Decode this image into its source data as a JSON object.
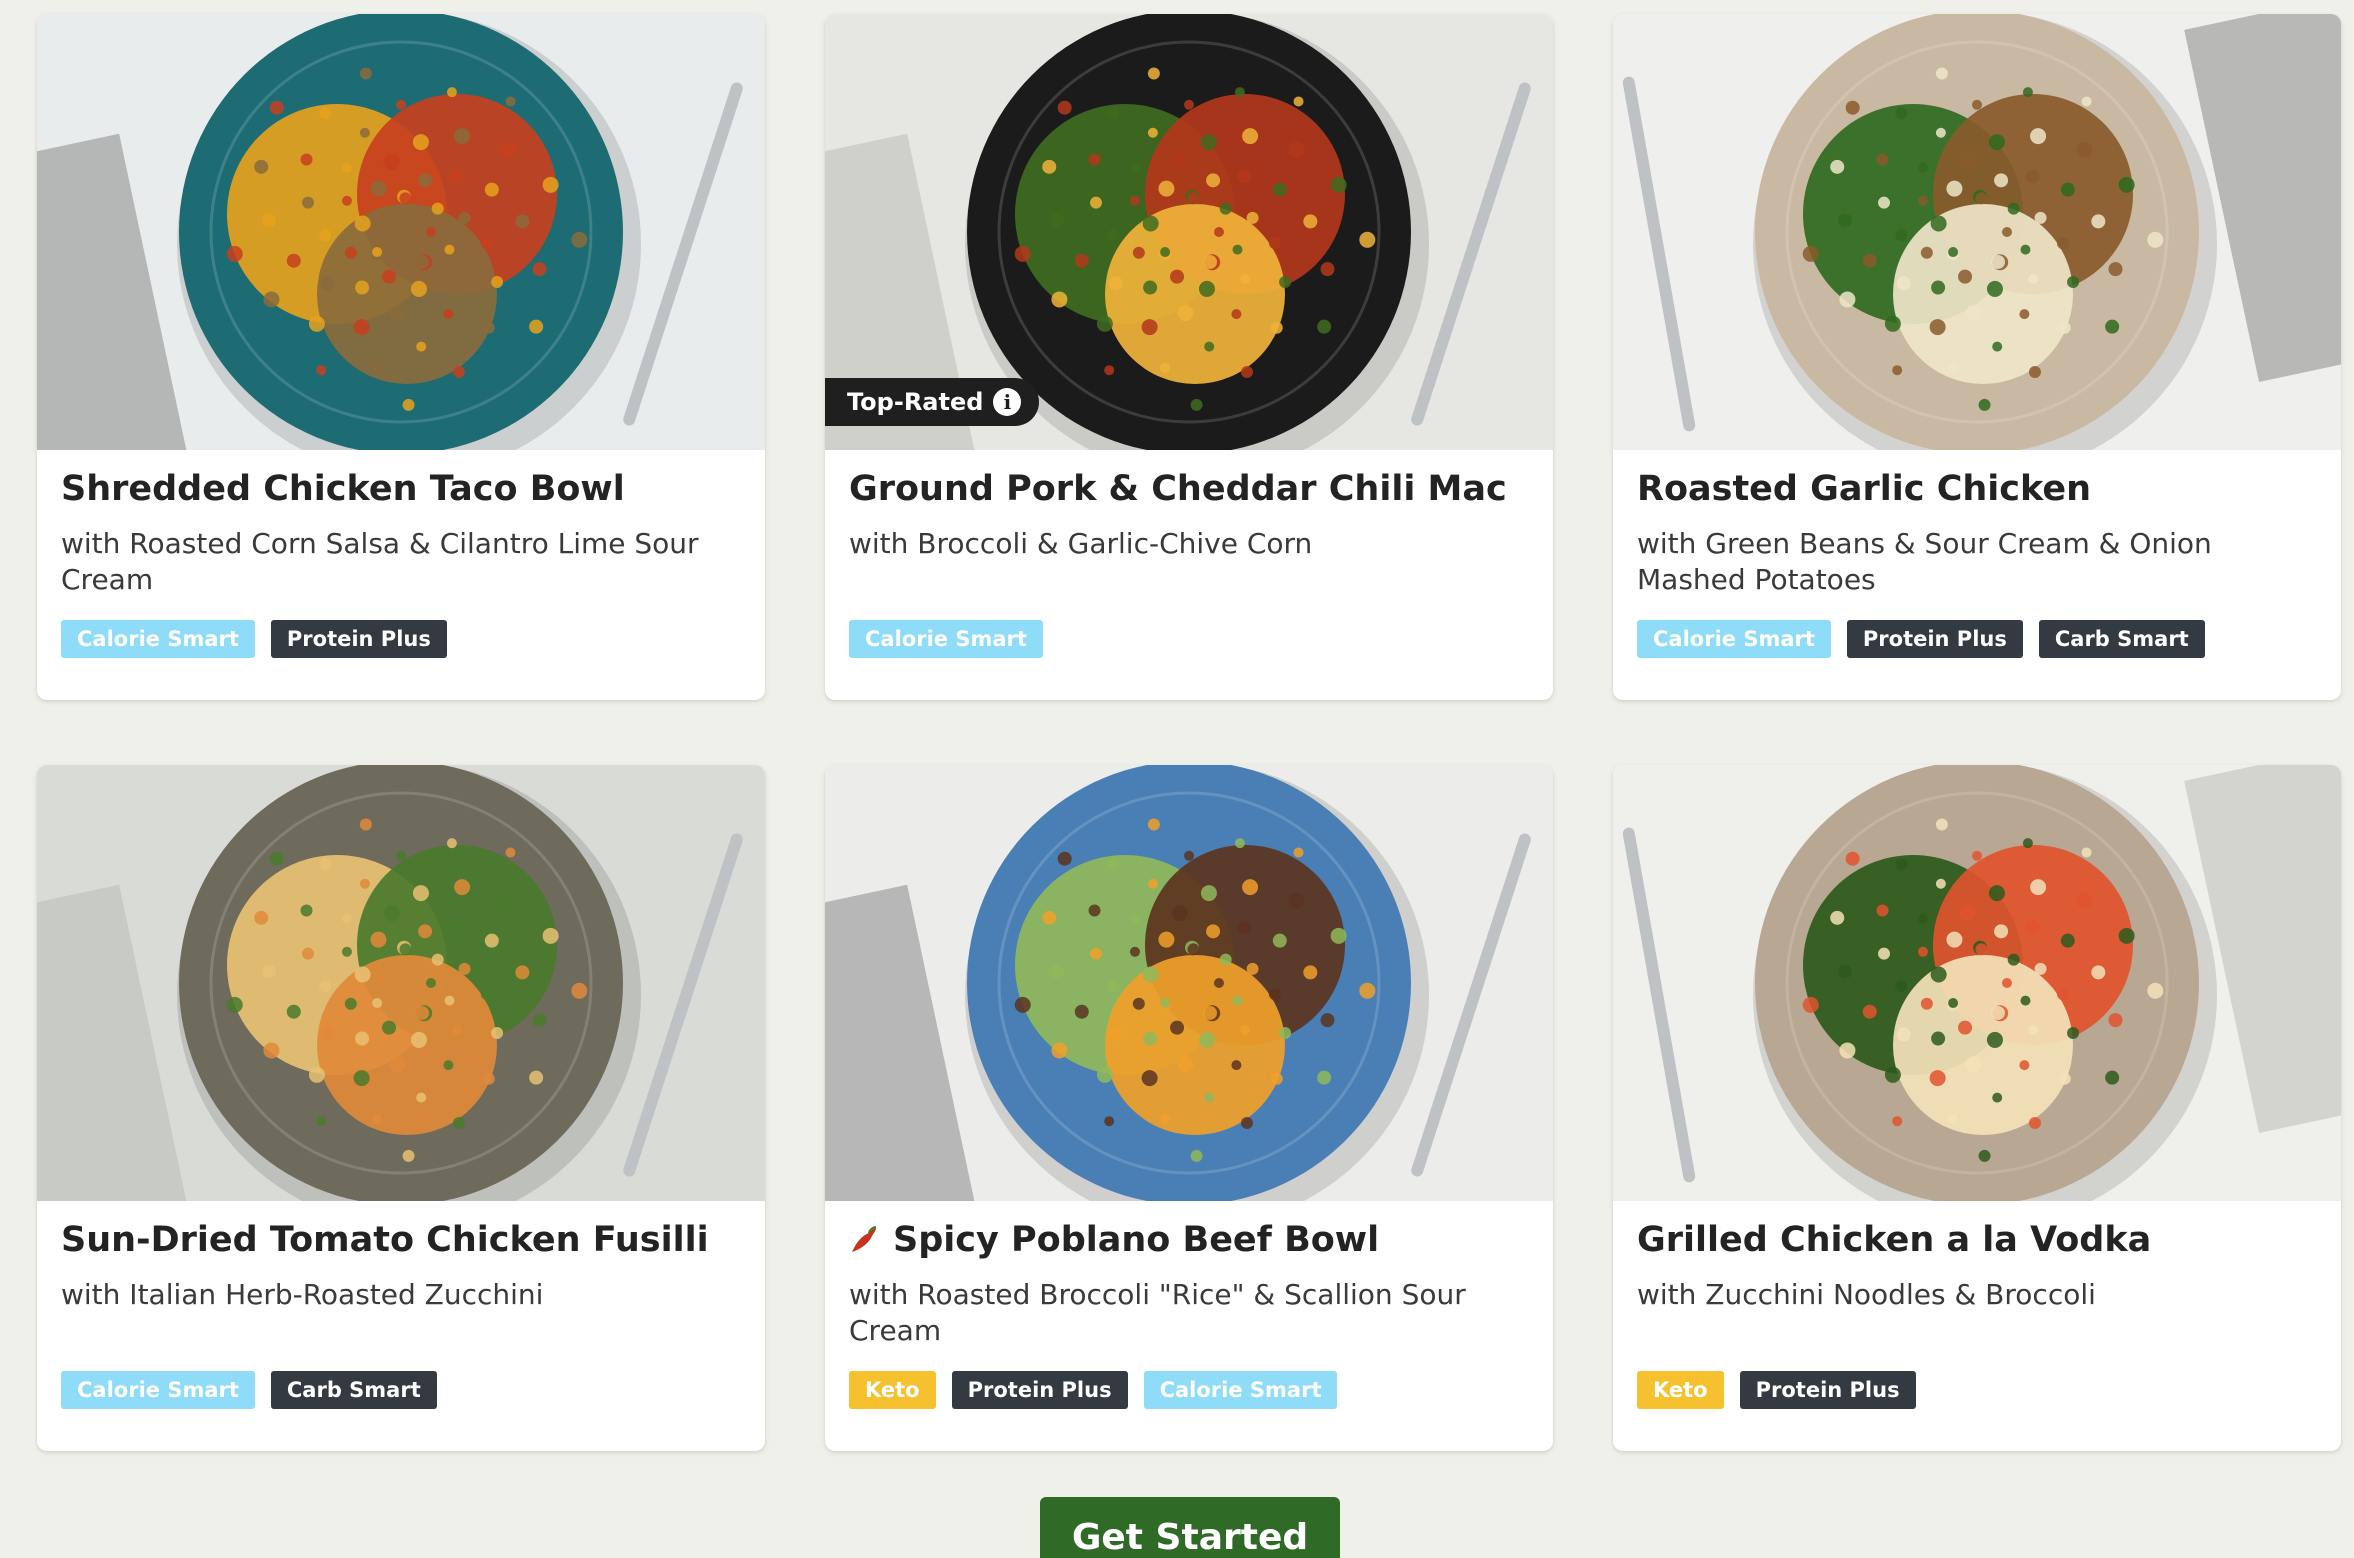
{
  "meals": [
    {
      "title": "Shredded Chicken Taco Bowl",
      "subtitle": "with Roasted Corn Salsa & Cilantro Lime Sour Cream",
      "tags": [
        {
          "label": "Calorie Smart",
          "kind": "calorie"
        },
        {
          "label": "Protein Plus",
          "kind": "protein"
        }
      ],
      "image": {
        "bg": "#e9ecec",
        "plate": "#1d6b73",
        "food": [
          "#e6a21d",
          "#c7401e",
          "#8a6b3c"
        ]
      }
    },
    {
      "title": "Ground Pork & Cheddar Chili Mac",
      "subtitle": "with Broccoli & Garlic-Chive Corn",
      "badge": "Top-Rated",
      "tags": [
        {
          "label": "Calorie Smart",
          "kind": "calorie"
        }
      ],
      "image": {
        "bg": "#e6e6e3",
        "plate": "#1b1b1b",
        "food": [
          "#3f6b1f",
          "#b3371b",
          "#f0b33a"
        ]
      }
    },
    {
      "title": "Roasted Garlic Chicken",
      "subtitle": "with Green Beans & Sour Cream & Onion Mashed Potatoes",
      "tags": [
        {
          "label": "Calorie Smart",
          "kind": "calorie"
        },
        {
          "label": "Protein Plus",
          "kind": "protein"
        },
        {
          "label": "Carb Smart",
          "kind": "carb"
        }
      ],
      "image": {
        "bg": "#efefed",
        "plate": "#c9b9a2",
        "food": [
          "#2f6a1f",
          "#8a5a2c",
          "#efe5c8"
        ]
      }
    },
    {
      "title": "Sun-Dried Tomato Chicken Fusilli",
      "subtitle": "with Italian Herb-Roasted Zucchini",
      "tags": [
        {
          "label": "Calorie Smart",
          "kind": "calorie"
        },
        {
          "label": "Carb Smart",
          "kind": "carb"
        }
      ],
      "image": {
        "bg": "#d9dbd6",
        "plate": "#6e6a5c",
        "food": [
          "#e8c173",
          "#4a7a2c",
          "#e08a3a"
        ]
      }
    },
    {
      "title": "Spicy Poblano Beef Bowl",
      "subtitle": "with Roasted Broccoli \"Rice\" & Scallion Sour Cream",
      "spicy": true,
      "tags": [
        {
          "label": "Keto",
          "kind": "keto"
        },
        {
          "label": "Protein Plus",
          "kind": "protein"
        },
        {
          "label": "Calorie Smart",
          "kind": "calorie"
        }
      ],
      "image": {
        "bg": "#ececea",
        "plate": "#4a7fb5",
        "food": [
          "#8fb85a",
          "#5b3420",
          "#f0a02a"
        ]
      }
    },
    {
      "title": "Grilled Chicken a la Vodka",
      "subtitle": "with Zucchini Noodles & Broccoli",
      "tags": [
        {
          "label": "Keto",
          "kind": "keto"
        },
        {
          "label": "Protein Plus",
          "kind": "protein"
        }
      ],
      "image": {
        "bg": "#efefec",
        "plate": "#b8a792",
        "food": [
          "#2d5a1c",
          "#e0542e",
          "#f3e2b8"
        ]
      }
    }
  ],
  "cta": {
    "label": "Get Started"
  },
  "icons": {
    "info": "info-icon",
    "pepper": "chili-pepper-icon"
  }
}
